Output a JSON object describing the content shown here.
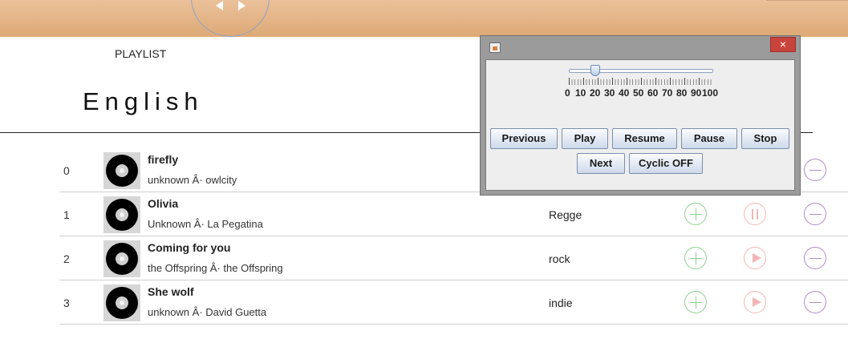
{
  "header": {
    "playlist_label": "PLAYLIST",
    "playlist_name": "English"
  },
  "songs": [
    {
      "index": "0",
      "title": "firefly",
      "artist": "unknown Â· owlcity",
      "genre": "",
      "state": "hidden"
    },
    {
      "index": "1",
      "title": "Olivia",
      "artist": "Unknown Â· La Pegatina",
      "genre": "Regge",
      "state": "pause"
    },
    {
      "index": "2",
      "title": "Coming for you",
      "artist": "the Offspring Â· the Offspring",
      "genre": "rock",
      "state": "play"
    },
    {
      "index": "3",
      "title": "She wolf",
      "artist": "unknown Â· David Guetta",
      "genre": "indie",
      "state": "play"
    }
  ],
  "player_window": {
    "close_label": "×",
    "volume_value": 15,
    "volume_range": [
      0,
      100
    ],
    "scale_labels": [
      "0",
      "10",
      "20",
      "30",
      "40",
      "50",
      "60",
      "70",
      "80",
      "90",
      "100"
    ],
    "buttons": {
      "previous": "Previous",
      "play": "Play",
      "resume": "Resume",
      "pause": "Pause",
      "stop": "Stop",
      "next": "Next",
      "cyclic": "Cyclic OFF"
    }
  },
  "colors": {
    "header_bg": "#e3b585",
    "add_icon": "#8fd08f",
    "play_icon": "#f3b6b6",
    "remove_icon": "#b08cc8",
    "close_button": "#c9433d"
  },
  "icons": {
    "row_add": "plus-circle-icon",
    "row_play": "play-circle-icon",
    "row_pause": "pause-circle-icon",
    "row_remove": "minus-circle-icon",
    "album": "vinyl-disc-icon",
    "window": "java-cup-icon"
  }
}
